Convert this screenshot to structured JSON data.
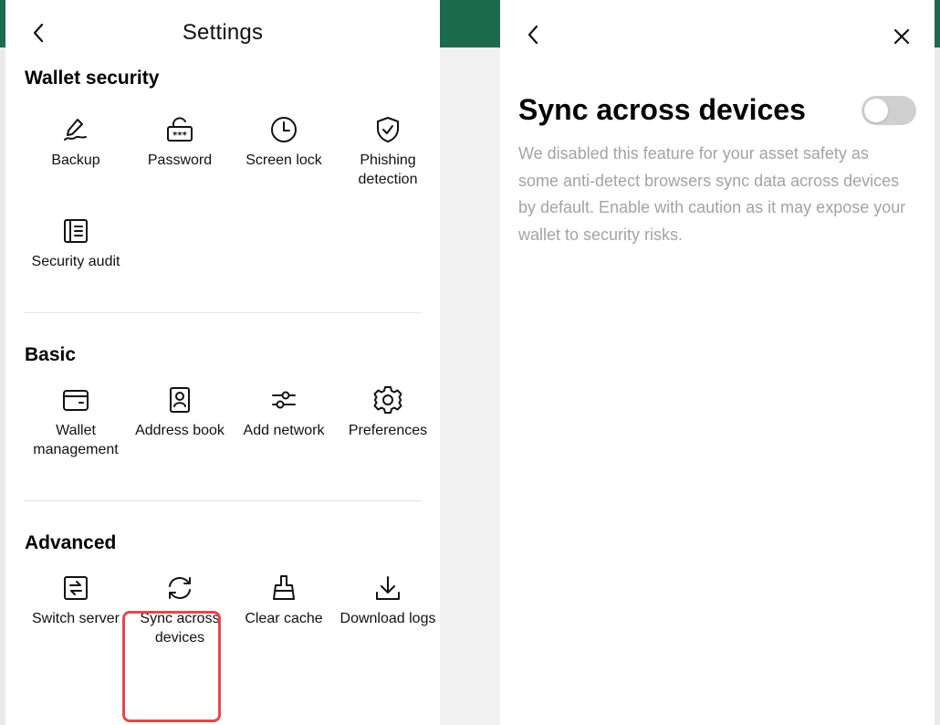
{
  "settings": {
    "title": "Settings",
    "sections": [
      {
        "title": "Wallet security",
        "items": [
          {
            "label": "Backup",
            "icon": "pen-signature-icon"
          },
          {
            "label": "Password",
            "icon": "lock-password-icon"
          },
          {
            "label": "Screen lock",
            "icon": "clock-icon"
          },
          {
            "label": "Phishing detection",
            "icon": "shield-check-icon"
          },
          {
            "label": "Security audit",
            "icon": "document-icon"
          }
        ]
      },
      {
        "title": "Basic",
        "items": [
          {
            "label": "Wallet management",
            "icon": "wallet-icon"
          },
          {
            "label": "Address book",
            "icon": "contact-book-icon"
          },
          {
            "label": "Add network",
            "icon": "sliders-icon"
          },
          {
            "label": "Preferences",
            "icon": "gear-icon"
          }
        ]
      },
      {
        "title": "Advanced",
        "items": [
          {
            "label": "Switch server",
            "icon": "switch-icon"
          },
          {
            "label": "Sync across devices",
            "icon": "sync-icon"
          },
          {
            "label": "Clear cache",
            "icon": "broom-icon"
          },
          {
            "label": "Download logs",
            "icon": "download-icon"
          }
        ]
      }
    ]
  },
  "sync_panel": {
    "title": "Sync across devices",
    "toggle_on": false,
    "description": "We disabled this feature for your asset safety as some anti-detect browsers sync data across devices by default. Enable with caution as it may expose your wallet to security risks."
  },
  "colors": {
    "highlight": "#e5484d",
    "toggle_off": "#cfcfcf",
    "description_text": "#a3a3a3"
  }
}
